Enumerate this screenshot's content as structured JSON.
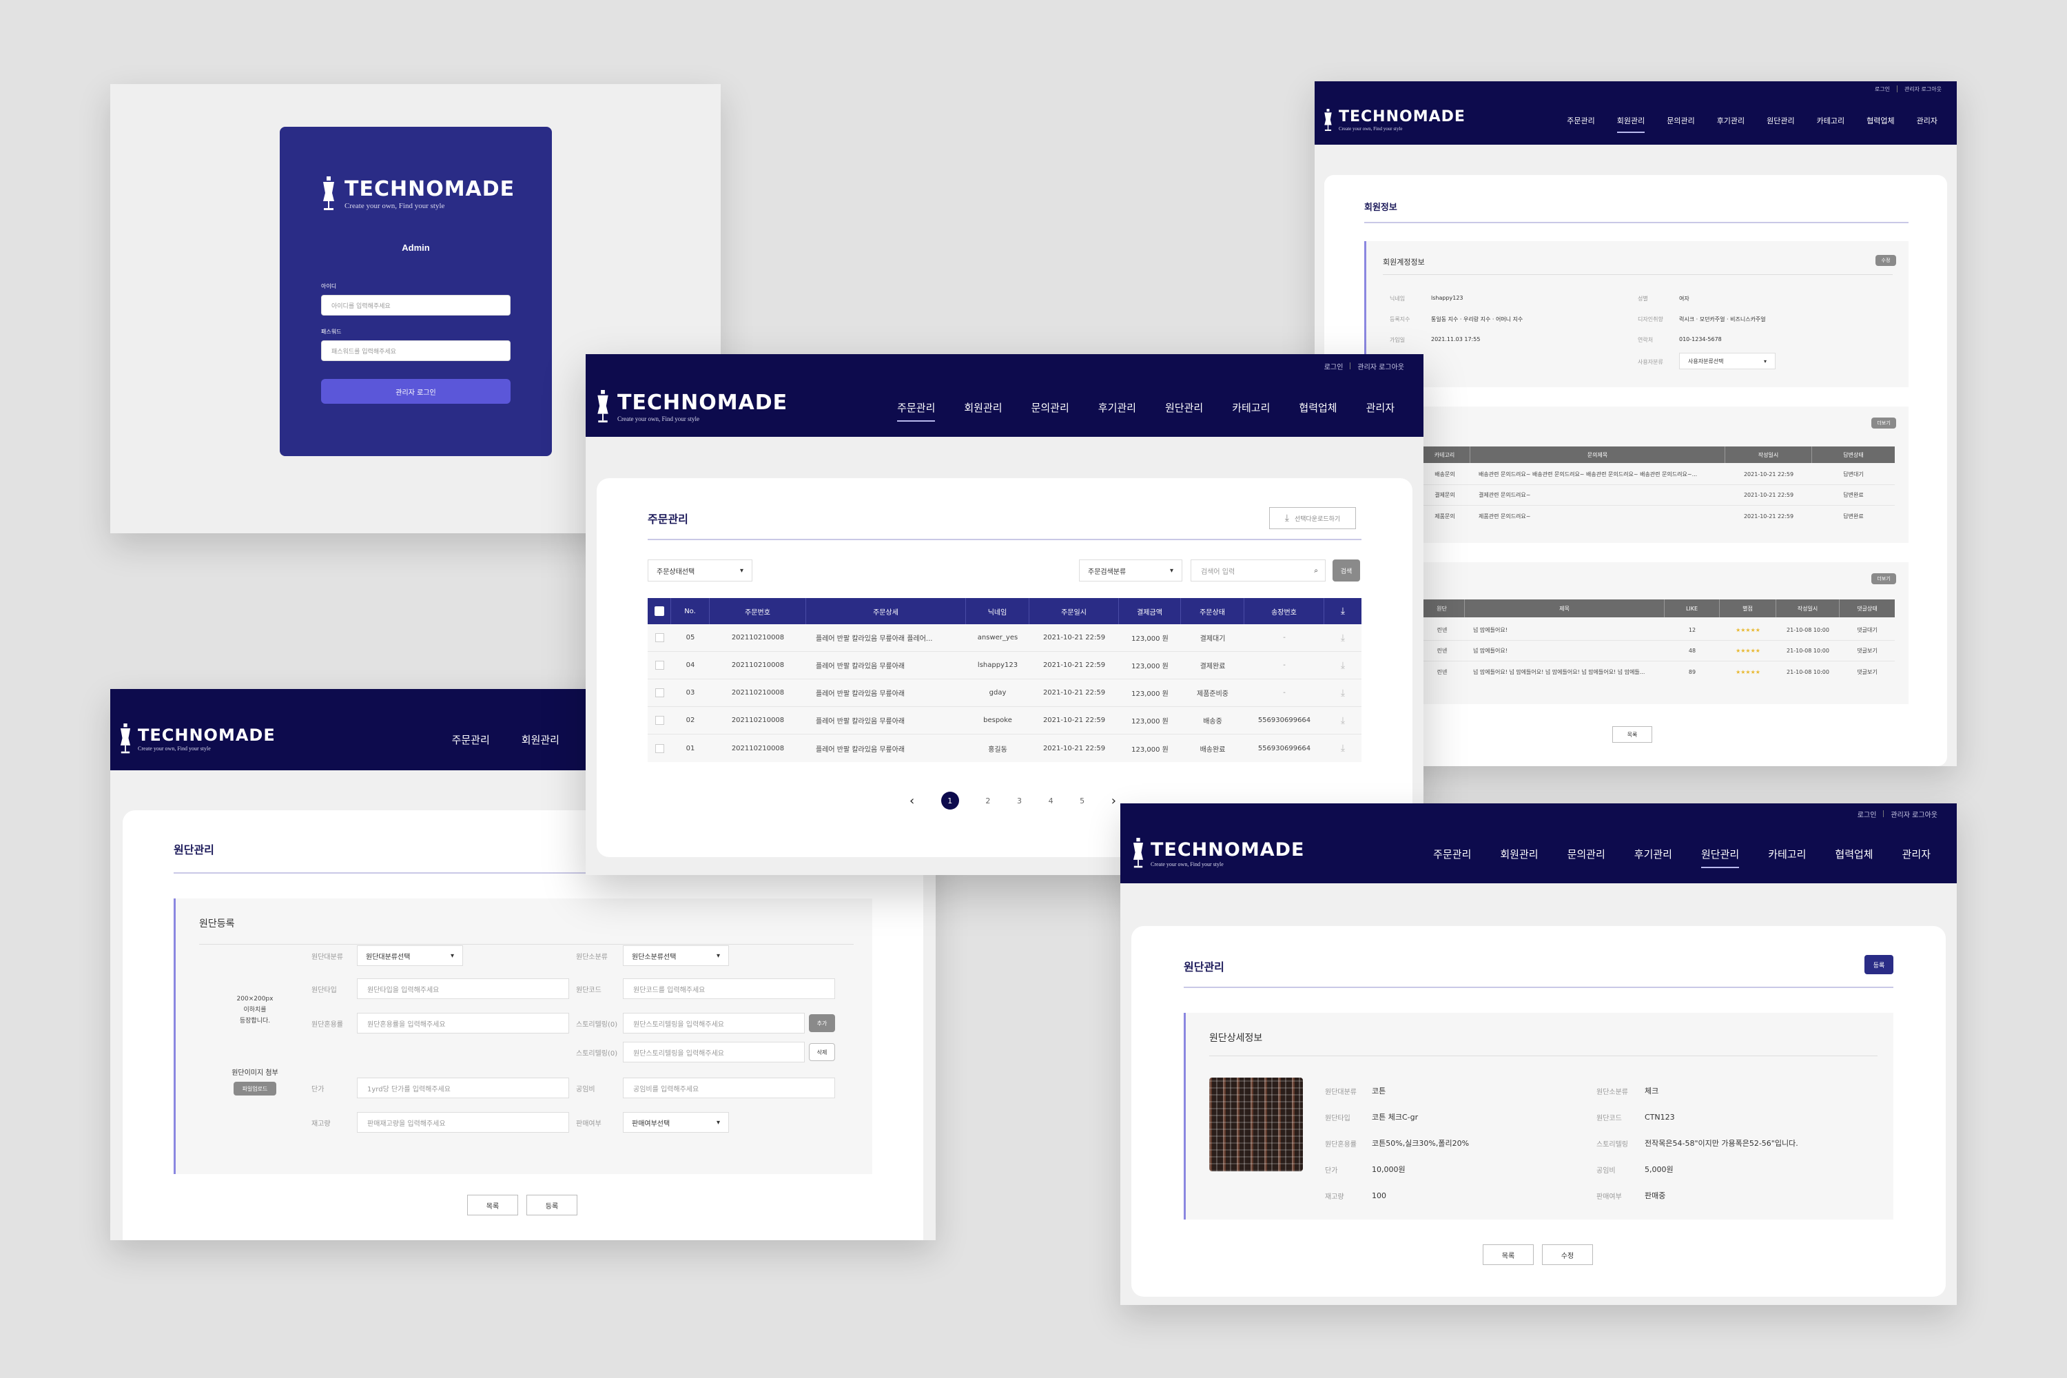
{
  "brand": {
    "name": "TECHNOMADE",
    "tagline": "Create your own, Find your style",
    "mini": "T/A"
  },
  "colors": {
    "navy": "#0d0b4d",
    "header_blue": "#2a2c86",
    "accent": "#5b57d9",
    "gray_header": "#6b6b6b"
  },
  "menu": [
    "주문관리",
    "회원관리",
    "문의관리",
    "후기관리",
    "원단관리",
    "카테고리",
    "협력업체",
    "관리자"
  ],
  "top_links": {
    "login": "로그인",
    "admin_logout": "관리자 로그아웃"
  },
  "login": {
    "title": "Admin",
    "id_label": "아이디",
    "id_placeholder": "아이디를 입력해주세요",
    "pw_label": "패스워드",
    "pw_placeholder": "패스워드를 입력해주세요",
    "submit": "관리자 로그인"
  },
  "orders": {
    "title": "주문관리",
    "download_selected": "선택다운로드하기",
    "status_filter": "주문상태선택",
    "search_category": "주문검색분류",
    "search_placeholder": "검색어 입력",
    "search_btn": "검색",
    "columns": [
      "No.",
      "주문번호",
      "주문상세",
      "닉네임",
      "주문일시",
      "결제금액",
      "주문상태",
      "송장번호"
    ],
    "rows": [
      {
        "no": "05",
        "order_no": "202110210008",
        "detail": "플레어 반팔 칼라있음 무릎아래 플레어...",
        "nick": "answer_yes",
        "date": "2021-10-21 22:59",
        "amount": "123,000 원",
        "status": "결제대기",
        "invoice": "-"
      },
      {
        "no": "04",
        "order_no": "202110210008",
        "detail": "플레어 반팔 칼라있음 무릎아래",
        "nick": "lshappy123",
        "date": "2021-10-21 22:59",
        "amount": "123,000 원",
        "status": "결제완료",
        "invoice": "-"
      },
      {
        "no": "03",
        "order_no": "202110210008",
        "detail": "플레어 반팔 칼라있음 무릎아래",
        "nick": "gday",
        "date": "2021-10-21 22:59",
        "amount": "123,000 원",
        "status": "제품준비중",
        "invoice": "-"
      },
      {
        "no": "02",
        "order_no": "202110210008",
        "detail": "플레어 반팔 칼라있음 무릎아래",
        "nick": "bespoke",
        "date": "2021-10-21 22:59",
        "amount": "123,000 원",
        "status": "배송중",
        "invoice": "556930699664"
      },
      {
        "no": "01",
        "order_no": "202110210008",
        "detail": "플레어 반팔 칼라있음 무릎아래",
        "nick": "홍길동",
        "date": "2021-10-21 22:59",
        "amount": "123,000 원",
        "status": "배송완료",
        "invoice": "556930699664"
      }
    ],
    "pages": [
      "1",
      "2",
      "3",
      "4",
      "5"
    ]
  },
  "member": {
    "title": "회원정보",
    "account_title": "회원계정정보",
    "edit": "수정",
    "more": "더보기",
    "list_btn": "목록",
    "fields": [
      {
        "label": "닉네임",
        "value": "lshappy123"
      },
      {
        "label": "성별",
        "value": "여자"
      },
      {
        "label": "등록지수",
        "value": "통일동 지수 · 우리랑 지수 · 어머니 지수"
      },
      {
        "label": "디자인취향",
        "value": "럭시크 · 모던카주얼 · 비즈니스카주얼"
      },
      {
        "label": "가입일",
        "value": "2021.11.03 17:55"
      },
      {
        "label": "연락처",
        "value": "010-1234-5678"
      },
      {
        "label": "사용자분류",
        "value": "사용자분류선택"
      }
    ],
    "inquiry_cols": [
      "카테고리",
      "문의제목",
      "작성일시",
      "답변상태"
    ],
    "inquiries": [
      {
        "cat": "배송문의",
        "title": "배송관련 문의드려요~ 배송관련 문의드려요~ 배송관련 문의드려요~ 배송관련 문의드려요~...",
        "date": "2021-10-21 22:59",
        "state": "답변대기"
      },
      {
        "cat": "결제문의",
        "title": "결제관련 문의드려요~",
        "date": "2021-10-21 22:59",
        "state": "답변완료"
      },
      {
        "cat": "제품문의",
        "title": "제품관련 문의드려요~",
        "date": "2021-10-21 22:59",
        "state": "답변완료"
      }
    ],
    "review_cols": [
      "원단",
      "제목",
      "LIKE",
      "별점",
      "작성일시",
      "댓글상태"
    ],
    "reviews": [
      {
        "cat": "린넨",
        "title": "넘 맘에들어요!",
        "like": "12",
        "stars": "★★★★★",
        "date": "21-10-08 10:00",
        "state": "댓글대기"
      },
      {
        "cat": "린넨",
        "title": "넘 맘에들어요!",
        "like": "48",
        "stars": "★★★★★",
        "date": "21-10-08 10:00",
        "state": "댓글보기"
      },
      {
        "cat": "린넨",
        "title": "넘 맘에들어요! 넘 맘에들어요! 넘 맘에들어요! 넘 맘에들어요! 넘 맘에들...",
        "like": "89",
        "stars": "★★★★★",
        "date": "21-10-08 10:00",
        "state": "댓글보기"
      }
    ]
  },
  "fabric_reg": {
    "title": "원단관리",
    "section": "원단등록",
    "image_note": [
      "200×200px",
      "이하치를",
      "등장합니다."
    ],
    "image_label": "원단이미지 첨부",
    "upload": "파일업로드",
    "rows": [
      {
        "l1": "원단대분류",
        "v1": "원단대분류선택",
        "l2": "원단소분류",
        "v2": "원단소분류선택"
      },
      {
        "l1": "원단타입",
        "v1": "원단타입을 입력해주세요",
        "l2": "원단코드",
        "v2": "원단코드를 입력해주세요"
      },
      {
        "l1": "원단혼용률",
        "v1": "원단혼용률을 입력해주세요",
        "l2": "스토리텔링(0)",
        "v2": "원단스토리텔링을 입력해주세요"
      },
      {
        "l1": "",
        "v1": "",
        "l2": "스토리텔링(0)",
        "v2": "원단스토리텔링을 입력해주세요"
      },
      {
        "l1": "단가",
        "v1": "1yrd당 단가를 입력해주세요",
        "l2": "공임비",
        "v2": "공임비를 입력해주세요"
      },
      {
        "l1": "재고량",
        "v1": "판매재고량을 입력해주세요",
        "l2": "판매여부",
        "v2": "판매여부선택"
      }
    ],
    "add": "추가",
    "del": "삭제",
    "list": "목록",
    "register": "등록"
  },
  "fabric_detail": {
    "title": "원단관리",
    "section": "원단상세정보",
    "register": "등록",
    "left": [
      {
        "label": "원단대분류",
        "value": "코튼"
      },
      {
        "label": "원단타입",
        "value": "코튼 체크C-gr"
      },
      {
        "label": "원단혼용률",
        "value": "코튼50%,실크30%,폴리20%"
      },
      {
        "label": "단가",
        "value": "10,000원"
      },
      {
        "label": "재고량",
        "value": "100"
      }
    ],
    "right": [
      {
        "label": "원단소분류",
        "value": "체크"
      },
      {
        "label": "원단코드",
        "value": "CTN123"
      },
      {
        "label": "스토리텔링",
        "value": "전작목은54-58\"이지만 가용폭은52-56\"입니다."
      },
      {
        "label": "공임비",
        "value": "5,000원"
      },
      {
        "label": "판매여부",
        "value": "판매중"
      }
    ],
    "list": "목록",
    "edit": "수정"
  }
}
